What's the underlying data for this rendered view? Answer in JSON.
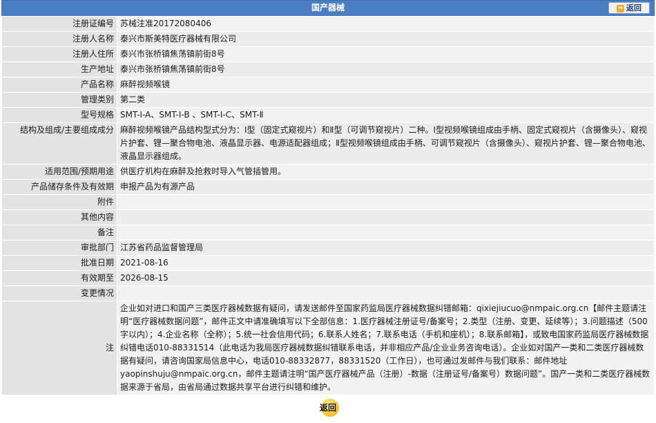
{
  "header": {
    "title": "国产器械",
    "back_label": "返回"
  },
  "rows": [
    {
      "label": "注册证编号",
      "value": "苏械注准20172080406"
    },
    {
      "label": "注册人名称",
      "value": "泰兴市斯美特医疗器械有限公司"
    },
    {
      "label": "注册人住所",
      "value": "泰兴市张桥镇焦荡镇前街8号"
    },
    {
      "label": "生产地址",
      "value": "泰兴市张桥镇焦荡镇前街8号"
    },
    {
      "label": "产品名称",
      "value": "麻醉视频喉镜"
    },
    {
      "label": "管理类别",
      "value": "第二类"
    },
    {
      "label": "型号规格",
      "value": "SMT-Ⅰ-A、SMT-Ⅰ-B 、SMT-Ⅰ-C、SMT-Ⅱ"
    },
    {
      "label": "结构及组成/主要组成成分",
      "value": "麻醉视频喉镜产品结构型式分为：Ⅰ型（固定式窥视片）和Ⅱ型（可调节窥视片）二种。Ⅰ型视频喉镜组成由手柄、固定式窥视片（含摄像头）、窥视片护套、锂—聚合物电池、液晶显示器、电源适配器组成；Ⅱ型视频喉镜组成由手柄、可调节窥视片（含摄像头）、窥视片护套、锂—聚合物电池、液晶显示器组成。"
    },
    {
      "label": "适用范围/预期用途",
      "value": "供医疗机构在麻醉及抢救时导入气管插管用。"
    },
    {
      "label": "产品储存条件及有效期",
      "value": "申报产品为有源产品"
    },
    {
      "label": "附件",
      "value": ""
    },
    {
      "label": "其他内容",
      "value": ""
    },
    {
      "label": "备注",
      "value": ""
    },
    {
      "label": "审批部门",
      "value": "江苏省药品监督管理局"
    },
    {
      "label": "批准日期",
      "value": "2021-08-16"
    },
    {
      "label": "有效期至",
      "value": "2026-08-15"
    },
    {
      "label": "变更情况",
      "value": ""
    }
  ],
  "note": {
    "label": "注",
    "text": "企业如对进口和国产三类医疗器械数据有疑问，请发送邮件至国家药监局医疗器械数据纠错邮箱：qixiejiucuo@nmpaic.org.cn【邮件主题请注明“医疗器械数据问题”，邮件正文中请准确填写以下全部信息：1.医疗器械注册证号/备案号；2.类型（注册、变更、延续等）；3.问题描述（500字以内）；4.企业名称（全称）；5.统一社会信用代码；6.联系人姓名；7.联系电话（手机和座机）；8.联系邮箱】，或致电国家药监局医疗器械数据纠错电话010-88331514（此电话为我局医疗器械数据纠错联系电话，并非相应产品/企业业务咨询电话）。企业如对国产一类和二类医疗器械数据有疑问，请咨询国家局信息中心，电话010-88332877，88331520（工作日），也可通过发邮件与我们联系：邮件地址yaopinshuju@nmpaic.org.cn，邮件主题请注明“国产医疗器械产品（注册）-数据（注册证号/备案号）数据问题”。国产一类和二类医疗器械数据来源于省局，由省局通过数据共享平台进行纠错和维护。"
  },
  "footer": {
    "back_label": "返回"
  },
  "colors": {
    "header_bg": "#4b7fc3",
    "label_bg": "#e3e3e3",
    "value_bg": "#f2f2f2",
    "back_button": "#f3a92f"
  }
}
